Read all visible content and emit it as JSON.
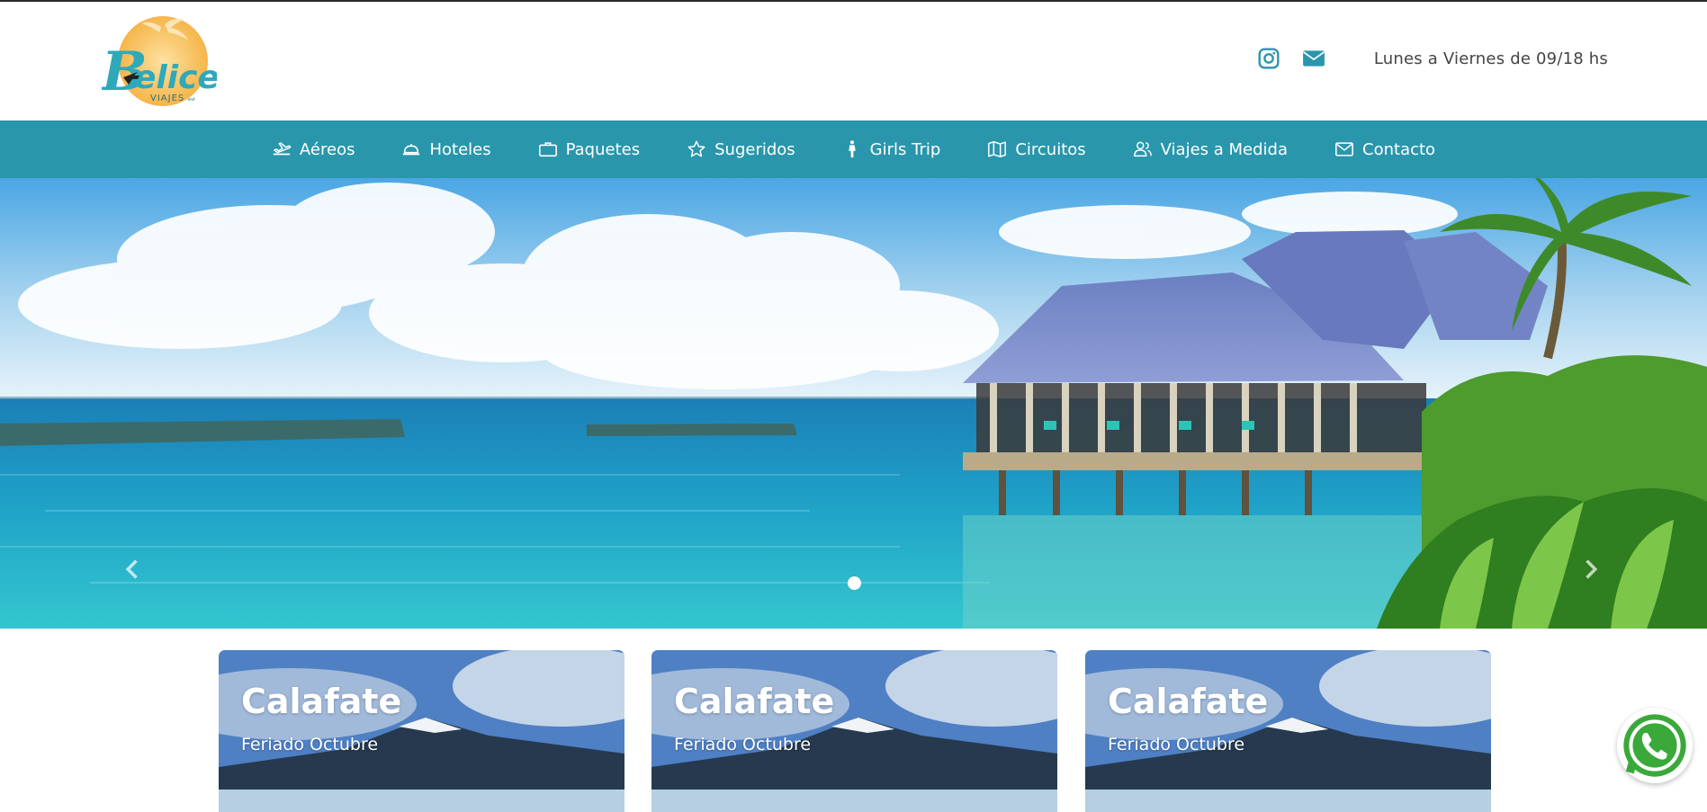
{
  "brand": {
    "logo_text": "Belice",
    "logo_subtext": "VIAJES",
    "logo_tag": "evt"
  },
  "header": {
    "social": [
      {
        "icon": "instagram-icon"
      },
      {
        "icon": "envelope-icon"
      }
    ],
    "hours": "Lunes a Viernes de 09/18 hs"
  },
  "nav": {
    "items": [
      {
        "label": "Aéreos",
        "icon": "plane-departure-icon"
      },
      {
        "label": "Hoteles",
        "icon": "bell-icon"
      },
      {
        "label": "Paquetes",
        "icon": "suitcase-icon"
      },
      {
        "label": "Sugeridos",
        "icon": "star-icon"
      },
      {
        "label": "Girls Trip",
        "icon": "female-icon"
      },
      {
        "label": "Circuitos",
        "icon": "map-icon"
      },
      {
        "label": "Viajes a Medida",
        "icon": "users-icon"
      },
      {
        "label": "Contacto",
        "icon": "mail-icon"
      }
    ]
  },
  "hero": {
    "slide_count": 1,
    "active_slide": 1
  },
  "cards": [
    {
      "title": "Calafate",
      "subtitle": "Feriado Octubre"
    },
    {
      "title": "Calafate",
      "subtitle": "Feriado Octubre"
    },
    {
      "title": "Calafate",
      "subtitle": "Feriado Octubre"
    }
  ],
  "colors": {
    "brand_teal": "#2a96ac",
    "logo_orange": "#f7b94a",
    "whatsapp_green": "#3aa93a"
  }
}
